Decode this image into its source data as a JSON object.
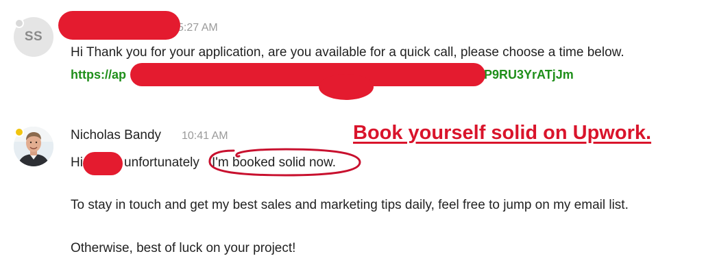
{
  "messages": [
    {
      "avatar_initials": "SS",
      "time": "5:27 AM",
      "body": "Hi Thank you for your application, are you available for a quick call, please choose a time below.",
      "link_visible_start": "https://ap",
      "link_visible_end": "P9RU3YrATjJm"
    },
    {
      "sender": "Nicholas Bandy",
      "time": "10:41 AM",
      "greeting": "Hi",
      "line1_middle": "unfortunately",
      "line1_circled": "I'm booked solid now.",
      "line2": "To stay in touch and get my best sales and marketing tips daily, feel free to jump on my email list.",
      "line3": "Otherwise, best of luck on your project!"
    }
  ],
  "annotation": {
    "headline": "Book yourself solid on Upwork."
  },
  "colors": {
    "redaction": "#e41b2f",
    "link": "#1f8f1a",
    "headline": "#d9142b",
    "timestamp": "#9a9a9a"
  }
}
